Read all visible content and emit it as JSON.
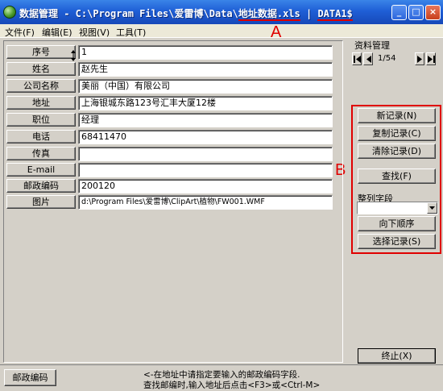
{
  "window": {
    "title_prefix": "数据管理 - C:\\Program Files\\爱雷博\\Data\\",
    "title_file": "地址数据.xls",
    "title_sep": " | ",
    "title_sheet": "DATA1$",
    "controls": [
      "_",
      "□",
      "×"
    ]
  },
  "menu": [
    {
      "label": "文件(F)"
    },
    {
      "label": "编辑(E)"
    },
    {
      "label": "视图(V)"
    },
    {
      "label": "工具(T)"
    }
  ],
  "annotations": {
    "a": "A",
    "b": "B"
  },
  "fields": [
    {
      "label": "序号",
      "value": "1"
    },
    {
      "label": "姓名",
      "value": "赵先生"
    },
    {
      "label": "公司名称",
      "value": "美丽（中国）有限公司"
    },
    {
      "label": "地址",
      "value": "上海银城东路123号汇丰大厦12楼"
    },
    {
      "label": "职位",
      "value": "经理"
    },
    {
      "label": "电话",
      "value": "68411470"
    },
    {
      "label": "传真",
      "value": ""
    },
    {
      "label": "E-mail",
      "value": ""
    },
    {
      "label": "邮政编码",
      "value": "200120"
    },
    {
      "label": "图片",
      "value": "d:\\Program Files\\爱雷博\\ClipArt\\植物\\FW001.WMF"
    }
  ],
  "panel": {
    "group_title": "资料管理",
    "record_position": "1/54",
    "buttons": {
      "new": "新记录(N)",
      "copy": "复制记录(C)",
      "clear": "清除记录(D)",
      "find": "查找(F)",
      "order": "向下顺序",
      "select": "选择记录(S)",
      "stop": "终止(X)"
    },
    "sort_label": "整列字段",
    "sort_value": ""
  },
  "status": {
    "button": "邮政编码",
    "line1": "<-在地址中请指定要输入的邮政编码字段.",
    "line2": "查找邮编时,输入地址后点击<F3>或<Ctrl-M>"
  }
}
